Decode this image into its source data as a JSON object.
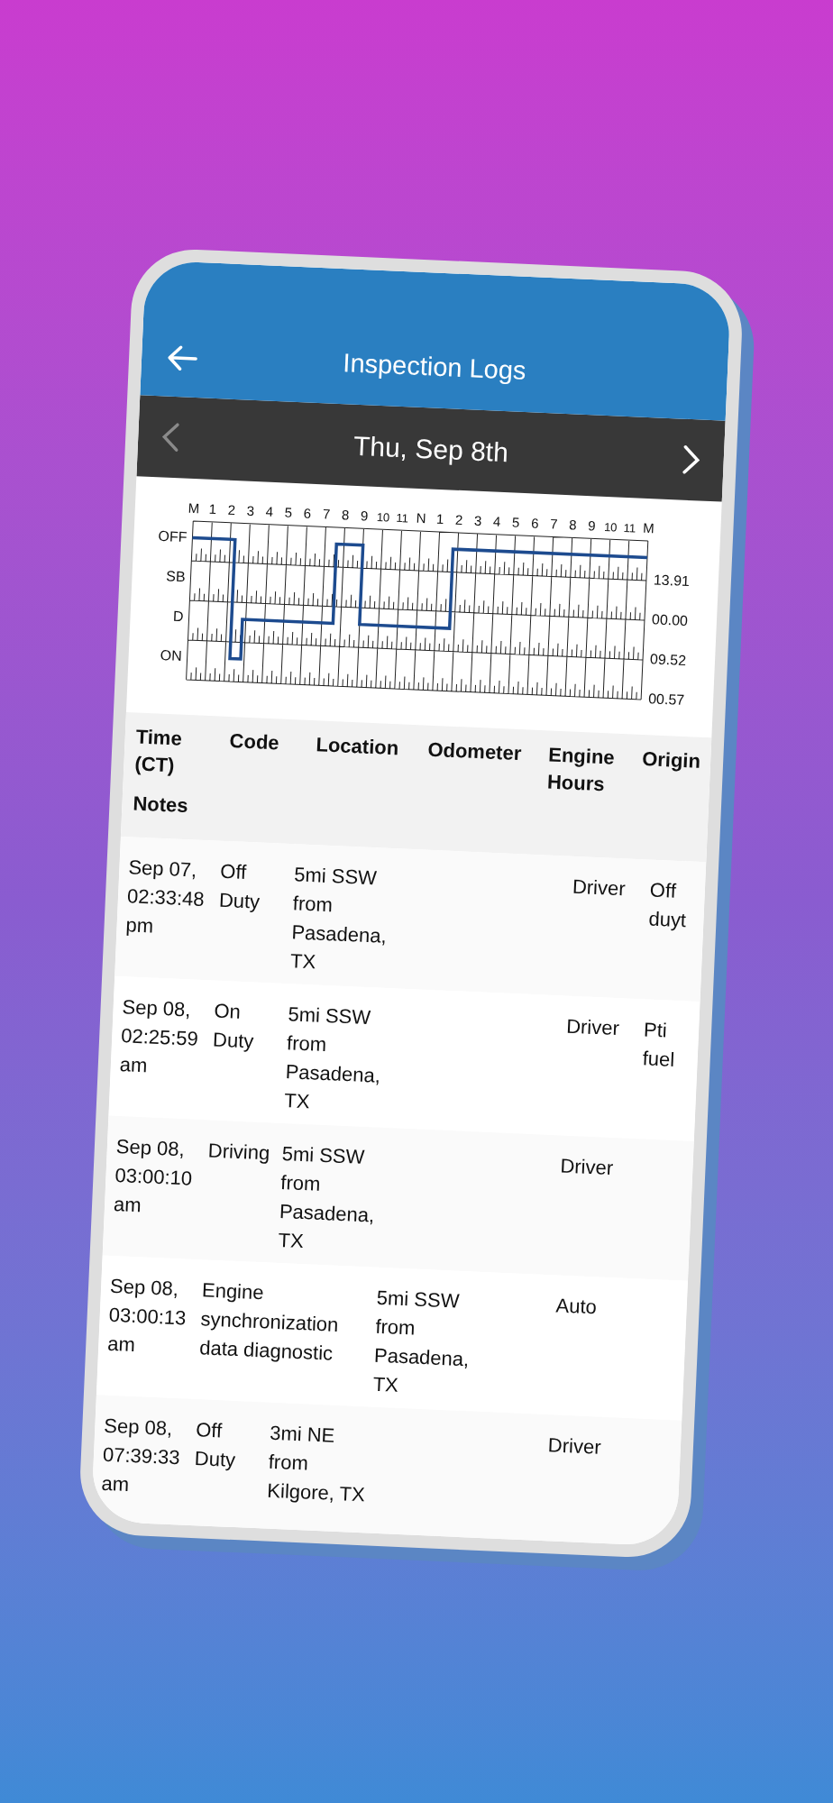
{
  "app_bar": {
    "title": "Inspection Logs"
  },
  "date_bar": {
    "label": "Thu, Sep 8th",
    "prev": {
      "disabled": true
    },
    "next": {
      "disabled": false
    }
  },
  "log_chart": {
    "hour_labels": [
      "M",
      "1",
      "2",
      "3",
      "4",
      "5",
      "6",
      "7",
      "8",
      "9",
      "10",
      "11",
      "N",
      "1",
      "2",
      "3",
      "4",
      "5",
      "6",
      "7",
      "8",
      "9",
      "10",
      "11",
      "M"
    ],
    "status_labels": [
      "OFF",
      "SB",
      "D",
      "ON"
    ],
    "totals": [
      "13.91",
      "00.00",
      "09.52",
      "00.57"
    ]
  },
  "table": {
    "columns": [
      "Time (CT)",
      "Code",
      "Location",
      "Odometer",
      "Engine Hours",
      "Origin",
      "Notes"
    ],
    "rows": [
      {
        "time": "Sep 07, 02:33:48 pm",
        "code": "Off Duty",
        "location": "5mi SSW from Pasadena, TX",
        "origin": "Driver",
        "notes": "Off duyt"
      },
      {
        "time": "Sep 08, 02:25:59 am",
        "code": "On Duty",
        "location": "5mi SSW from Pasadena, TX",
        "origin": "Driver",
        "notes": "Pti fuel"
      },
      {
        "time": "Sep 08, 03:00:10 am",
        "code": "Driving",
        "location": "5mi SSW from Pasadena, TX",
        "origin": "Driver"
      },
      {
        "time": "Sep 08, 03:00:13 am",
        "code": "Engine synchronization data diagnostic",
        "location": "5mi SSW from Pasadena, TX",
        "origin": "Auto"
      },
      {
        "time": "Sep 08, 07:39:33 am",
        "code": "Off Duty",
        "location": "3mi NE from Kilgore, TX",
        "origin": "Driver"
      }
    ]
  }
}
